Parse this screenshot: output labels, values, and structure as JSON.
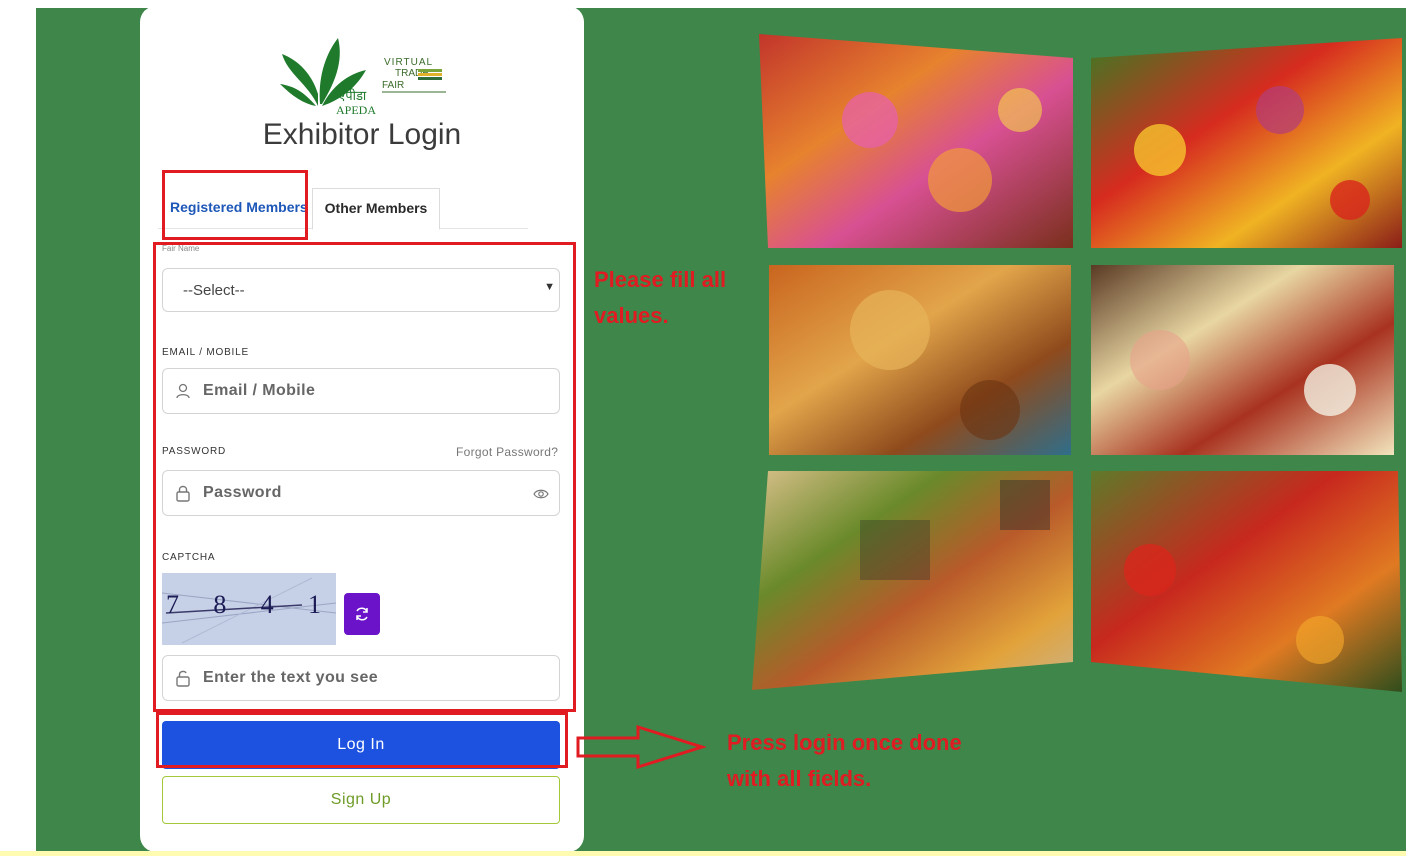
{
  "logo": {
    "org_hindi": "एपीडा",
    "org": "APEDA",
    "line1": "VIRTUAL",
    "line2": "TRADE",
    "line3": "FAIR"
  },
  "page": {
    "title": "Exhibitor Login"
  },
  "tabs": [
    {
      "label": "Registered Members",
      "active": false
    },
    {
      "label": "Other Members",
      "active": true
    }
  ],
  "form": {
    "fair_label": "Fair Name",
    "fair_select_value": "--Select--",
    "email_label": "EMAIL / MOBILE",
    "email_placeholder": "Email / Mobile",
    "password_label": "PASSWORD",
    "forgot_password": "Forgot Password?",
    "password_placeholder": "Password",
    "captcha_label": "CAPTCHA",
    "captcha_text": "7841",
    "captcha_placeholder": "Enter the text you see",
    "login_label": "Log In",
    "signup_label": "Sign Up"
  },
  "annotations": {
    "fill_note": "Please fill all values.",
    "login_note": "Press login once done with all fields."
  },
  "photos": [
    "flowers",
    "fresh-vegetables",
    "snacks",
    "dairy-meat-eggs",
    "grains-pulses",
    "vegetables-basket"
  ],
  "colors": {
    "background_green": "#3e8649",
    "highlight_red": "#e01b22",
    "login_blue": "#1d52e0",
    "refresh_purple": "#6a13c9",
    "tab_blue": "#1d57b8",
    "signup_green": "#6f9b27"
  }
}
